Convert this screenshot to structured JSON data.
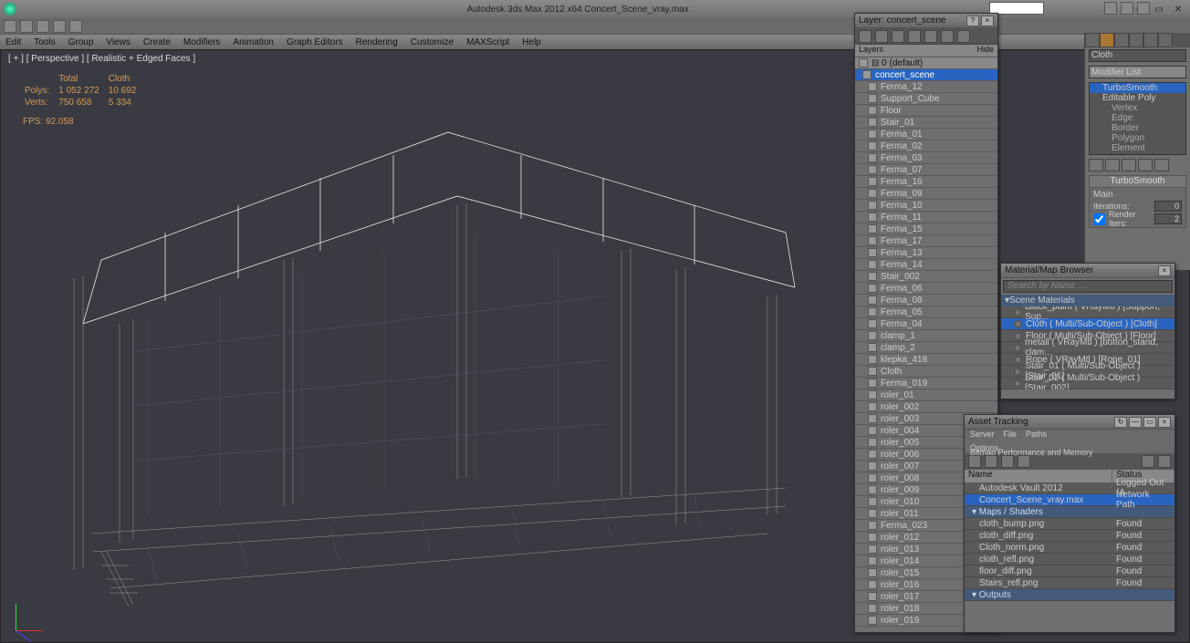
{
  "app": {
    "title": "Autodesk 3ds Max 2012 x64   Concert_Scene_vray.max"
  },
  "menus": [
    "Edit",
    "Tools",
    "Group",
    "Views",
    "Create",
    "Modifiers",
    "Animation",
    "Graph Editors",
    "Rendering",
    "Customize",
    "MAXScript",
    "Help"
  ],
  "viewport": {
    "label": "[ + ] [ Perspective ] [ Realistic + Edged Faces ]",
    "stats_h1": "Total",
    "stats_h2": "Cloth",
    "polys_l": "Polys:",
    "polys_t": "1 052 272",
    "polys_c": "10 692",
    "verts_l": "Verts:",
    "verts_t": "750 658",
    "verts_c": "5 334",
    "fps": "FPS: 92.058"
  },
  "layer": {
    "title": "Layer: concert_scene",
    "hdr_layers": "Layers",
    "hdr_hide": "Hide",
    "root": "0 (default)",
    "group": "concert_scene",
    "items": [
      "Ferma_12",
      "Support_Cube",
      "Floor",
      "Stair_01",
      "Ferma_01",
      "Ferma_02",
      "Ferma_03",
      "Ferma_07",
      "Ferma_16",
      "Ferma_09",
      "Ferma_10",
      "Ferma_11",
      "Ferma_15",
      "Ferma_17",
      "Ferma_13",
      "Ferma_14",
      "Stair_002",
      "Ferma_06",
      "Ferma_08",
      "Ferma_05",
      "Ferma_04",
      "clamp_1",
      "clamp_2",
      "klepka_418",
      "Cloth",
      "Ferma_019",
      "roler_01",
      "roler_002",
      "roler_003",
      "roler_004",
      "roler_005",
      "roler_006",
      "roler_007",
      "roler_008",
      "roler_009",
      "roler_010",
      "roler_011",
      "Ferma_023",
      "roler_012",
      "roler_013",
      "roler_014",
      "roler_015",
      "roler_016",
      "roler_017",
      "roler_018",
      "roler_019"
    ]
  },
  "cmd": {
    "obj": "Cloth",
    "modlist": "Modifier List",
    "stack": {
      "top": "TurboSmooth",
      "base": "Editable Poly",
      "subs": [
        "Vertex",
        "Edge",
        "Border",
        "Polygon",
        "Element"
      ]
    },
    "rollup": "TurboSmooth",
    "main": "Main",
    "iter_l": "Iterations:",
    "iter_v": "0",
    "rend_l": "Render Iters:",
    "rend_v": "2"
  },
  "mat": {
    "title": "Material/Map Browser",
    "search": "Search by Name ...",
    "cat": "Scene Materials",
    "items": [
      "Black_paint ( VRayMtl ) [Support, Sup...",
      "Cloth ( Multi/Sub-Object ) [Cloth]",
      "Floor ( Multi/Sub-Object ) [Floor]",
      "metall ( VRayMtl ) [botton_stand, clam...",
      "Rope ( VRayMtl ) [Rope_01]",
      "Stair_01 ( Multi/Sub-Object ) [Stair_01]",
      "Stair_02 ( Multi/Sub-Object ) [Stair_002]"
    ],
    "sel": 1
  },
  "asset": {
    "title": "Asset Tracking",
    "menus": [
      "Server",
      "File",
      "Paths",
      "Bitmap Performance and Memory",
      "Options"
    ],
    "hdr_name": "Name",
    "hdr_status": "Status",
    "rows": [
      {
        "n": "Autodesk Vault 2012",
        "s": "Logged Out (A",
        "cat": false,
        "sel": false
      },
      {
        "n": "Concert_Scene_vray.max",
        "s": "Network Path",
        "cat": false,
        "sel": true
      },
      {
        "n": "Maps / Shaders",
        "s": "",
        "cat": true,
        "sel": false
      },
      {
        "n": "cloth_bump.png",
        "s": "Found",
        "cat": false,
        "sel": false
      },
      {
        "n": "cloth_diff.png",
        "s": "Found",
        "cat": false,
        "sel": false
      },
      {
        "n": "Cloth_norm.png",
        "s": "Found",
        "cat": false,
        "sel": false
      },
      {
        "n": "cloth_refl.png",
        "s": "Found",
        "cat": false,
        "sel": false
      },
      {
        "n": "floor_diff.png",
        "s": "Found",
        "cat": false,
        "sel": false
      },
      {
        "n": "Stairs_refl.png",
        "s": "Found",
        "cat": false,
        "sel": false
      },
      {
        "n": "Outputs",
        "s": "",
        "cat": true,
        "sel": false
      }
    ]
  }
}
